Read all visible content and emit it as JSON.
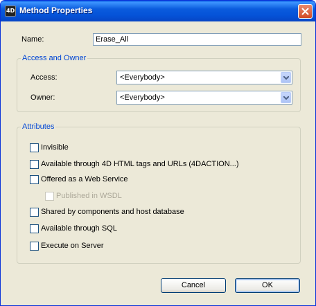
{
  "window": {
    "title": "Method Properties",
    "icon": "4d-app-icon"
  },
  "name_field": {
    "label": "Name:",
    "value": "Erase_All"
  },
  "access_owner": {
    "title": "Access and Owner",
    "access_label": "Access:",
    "access_value": "<Everybody>",
    "owner_label": "Owner:",
    "owner_value": "<Everybody>"
  },
  "attributes": {
    "title": "Attributes",
    "items": [
      {
        "label": "Invisible",
        "checked": false,
        "enabled": true
      },
      {
        "label": "Available through 4D HTML tags and URLs (4DACTION...)",
        "checked": false,
        "enabled": true
      },
      {
        "label": "Offered as a Web Service",
        "checked": false,
        "enabled": true
      },
      {
        "label": "Published in WSDL",
        "checked": false,
        "enabled": false
      },
      {
        "label": "Shared by components and host database",
        "checked": false,
        "enabled": true
      },
      {
        "label": "Available through SQL",
        "checked": false,
        "enabled": true
      },
      {
        "label": "Execute on Server",
        "checked": false,
        "enabled": true
      }
    ]
  },
  "buttons": {
    "cancel": "Cancel",
    "ok": "OK"
  },
  "colors": {
    "titlebar": "#0553d8",
    "dialog_bg": "#ece9d8",
    "group_title": "#0046d5",
    "close": "#d24b27"
  }
}
